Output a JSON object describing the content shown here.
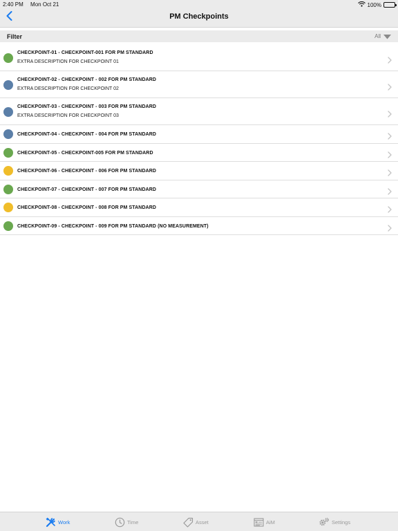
{
  "status_bar": {
    "time": "2:40 PM",
    "date": "Mon Oct 21",
    "wifi_icon": "wifi-icon",
    "battery": "100%",
    "battery_level": 1.0
  },
  "nav": {
    "title": "PM Checkpoints",
    "back_icon": "chevron-left-icon"
  },
  "filter": {
    "label": "Filter",
    "value": "All"
  },
  "colors": {
    "green": "#6aa84f",
    "blue": "#5b7fa8",
    "yellow": "#f0bd2a",
    "accent": "#1a7cf0"
  },
  "checkpoints": [
    {
      "title": "CHECKPOINT-01 - CHECKPOINT-001 FOR PM STANDARD",
      "description": "EXTRA DESCRIPTION FOR CHECKPOINT 01",
      "status_color": "green"
    },
    {
      "title": "CHECKPOINT-02 - CHECKPOINT - 002 FOR PM STANDARD",
      "description": "EXTRA DESCRIPTION FOR CHECKPOINT 02",
      "status_color": "blue"
    },
    {
      "title": "CHECKPOINT-03 - CHECKPOINT - 003 FOR PM STANDARD",
      "description": "EXTRA DESCRIPTION FOR CHECKPOINT 03",
      "status_color": "blue"
    },
    {
      "title": "CHECKPOINT-04 - CHECKPOINT - 004 FOR PM STANDARD",
      "description": "",
      "status_color": "blue"
    },
    {
      "title": "CHECKPOINT-05 - CHECKPOINT-005 FOR PM STANDARD",
      "description": "",
      "status_color": "green"
    },
    {
      "title": "CHECKPOINT-06 - CHECKPOINT - 006 FOR PM STANDARD",
      "description": "",
      "status_color": "yellow"
    },
    {
      "title": "CHECKPOINT-07 - CHECKPOINT - 007 FOR PM STANDARD",
      "description": "",
      "status_color": "green"
    },
    {
      "title": "CHECKPOINT-08 - CHECKPOINT - 008 FOR PM STANDARD",
      "description": "",
      "status_color": "yellow"
    },
    {
      "title": "CHECKPOINT-09 - CHECKPOINT - 009 FOR PM STANDARD (NO MEASUREMENT)",
      "description": "",
      "status_color": "green"
    }
  ],
  "tabs": [
    {
      "label": "Work",
      "icon": "wrench-screwdriver-icon",
      "active": true
    },
    {
      "label": "Time",
      "icon": "clock-icon",
      "active": false
    },
    {
      "label": "Asset",
      "icon": "tag-icon",
      "active": false
    },
    {
      "label": "AiM",
      "icon": "form-icon",
      "active": false
    },
    {
      "label": "Settings",
      "icon": "gears-icon",
      "active": false
    }
  ]
}
